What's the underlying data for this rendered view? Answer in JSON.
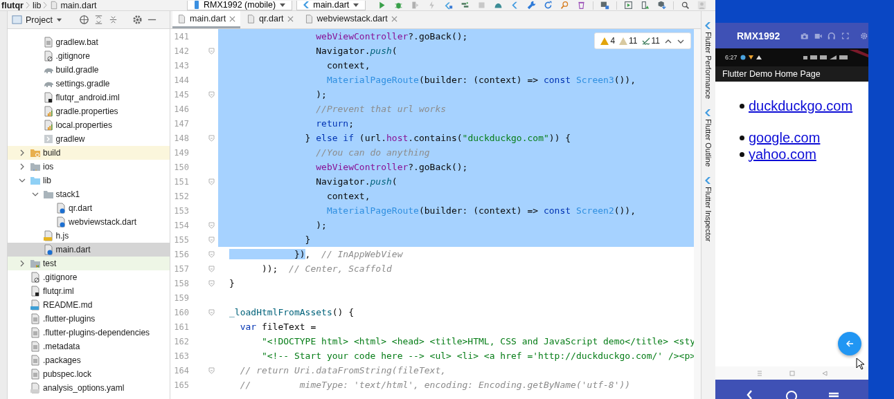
{
  "breadcrumbs": [
    "flutqr",
    "lib",
    "main.dart"
  ],
  "device_selector": {
    "label": "RMX1992 (mobile)"
  },
  "run_config": {
    "label": "main.dart"
  },
  "project_panel": {
    "title": "Project",
    "tree_continuation": [
      {
        "label": "gradlew.bat",
        "kind": "text",
        "selected": false
      },
      {
        "label": ".gitignore",
        "kind": "ignore",
        "selected": false
      },
      {
        "label": "build.gradle",
        "kind": "gradle",
        "selected": false
      },
      {
        "label": "settings.gradle",
        "kind": "gradle",
        "selected": false
      },
      {
        "label": "flutqr_android.iml",
        "kind": "iml",
        "selected": false
      },
      {
        "label": "gradle.properties",
        "kind": "properties",
        "selected": false
      },
      {
        "label": "local.properties",
        "kind": "properties",
        "selected": false
      },
      {
        "label": "gradlew",
        "kind": "script",
        "selected": false
      }
    ],
    "tree": [
      {
        "label": "build",
        "kind": "excluded-folder",
        "selected": false,
        "expanded": false
      },
      {
        "label": "ios",
        "kind": "ios-folder",
        "selected": false,
        "expanded": false
      },
      {
        "label": "lib",
        "kind": "source-folder",
        "selected": false,
        "expanded": true,
        "children": [
          {
            "label": "stack1",
            "kind": "folder",
            "selected": false,
            "expanded": true,
            "children": [
              {
                "label": "qr.dart",
                "kind": "dart",
                "selected": false
              },
              {
                "label": "webviewstack.dart",
                "kind": "dart",
                "selected": false
              }
            ]
          },
          {
            "label": "h.js",
            "kind": "js",
            "selected": false
          },
          {
            "label": "main.dart",
            "kind": "dart",
            "selected": true
          }
        ]
      },
      {
        "label": "test",
        "kind": "test-folder",
        "selected": false,
        "expanded": false
      },
      {
        "label": ".gitignore",
        "kind": "ignore",
        "selected": false
      },
      {
        "label": "flutqr.iml",
        "kind": "iml",
        "selected": false
      },
      {
        "label": "README.md",
        "kind": "markdown",
        "selected": false
      },
      {
        "label": ".flutter-plugins",
        "kind": "text",
        "selected": false
      },
      {
        "label": ".flutter-plugins-dependencies",
        "kind": "text",
        "selected": false
      },
      {
        "label": ".metadata",
        "kind": "text",
        "selected": false
      },
      {
        "label": ".packages",
        "kind": "text",
        "selected": false
      },
      {
        "label": "pubspec.lock",
        "kind": "text",
        "selected": false
      },
      {
        "label": "analysis_options.yaml",
        "kind": "yaml",
        "selected": false
      }
    ]
  },
  "editor_tabs": [
    {
      "label": "main.dart",
      "selected": true
    },
    {
      "label": "qr.dart",
      "selected": false
    },
    {
      "label": "webviewstack.dart",
      "selected": false
    }
  ],
  "inspection_widget": {
    "errors": "4",
    "warnings": "11",
    "typos": "11"
  },
  "code_lines": [
    {
      "number": "141",
      "selected": true,
      "fold": false,
      "tokens": [
        {
          "text": "                webViewController",
          "kind": "field"
        },
        {
          "text": "?.goBack();",
          "kind": "plain"
        }
      ]
    },
    {
      "number": "142",
      "selected": true,
      "fold": true,
      "tokens": [
        {
          "text": "                Navigator.",
          "kind": "plain"
        },
        {
          "text": "push",
          "kind": "method"
        },
        {
          "text": "(",
          "kind": "plain"
        }
      ]
    },
    {
      "number": "143",
      "selected": true,
      "fold": false,
      "tokens": [
        {
          "text": "                  context,",
          "kind": "plain"
        }
      ]
    },
    {
      "number": "144",
      "selected": true,
      "fold": false,
      "tokens": [
        {
          "text": "                  MaterialPageRoute",
          "kind": "class"
        },
        {
          "text": "(builder: (context) => ",
          "kind": "plain"
        },
        {
          "text": "const ",
          "kind": "keyword"
        },
        {
          "text": "Screen3",
          "kind": "class"
        },
        {
          "text": "()),",
          "kind": "plain"
        }
      ]
    },
    {
      "number": "145",
      "selected": true,
      "fold": true,
      "tokens": [
        {
          "text": "                );",
          "kind": "plain"
        }
      ]
    },
    {
      "number": "146",
      "selected": true,
      "fold": false,
      "tokens": [
        {
          "text": "                //Prevent that url works",
          "kind": "comment"
        }
      ]
    },
    {
      "number": "147",
      "selected": true,
      "fold": false,
      "tokens": [
        {
          "text": "                return",
          "kind": "keyword"
        },
        {
          "text": ";",
          "kind": "plain"
        }
      ]
    },
    {
      "number": "148",
      "selected": true,
      "fold": true,
      "tokens": [
        {
          "text": "              } ",
          "kind": "plain"
        },
        {
          "text": "else if",
          "kind": "keyword"
        },
        {
          "text": " (url.",
          "kind": "plain"
        },
        {
          "text": "host",
          "kind": "field"
        },
        {
          "text": ".contains(",
          "kind": "plain"
        },
        {
          "text": "\"duckduckgo.com\"",
          "kind": "string"
        },
        {
          "text": ")) {",
          "kind": "plain"
        }
      ]
    },
    {
      "number": "149",
      "selected": true,
      "fold": false,
      "tokens": [
        {
          "text": "                //You can do anything",
          "kind": "comment"
        }
      ]
    },
    {
      "number": "150",
      "selected": true,
      "fold": false,
      "tokens": [
        {
          "text": "                webViewController",
          "kind": "field"
        },
        {
          "text": "?.goBack();",
          "kind": "plain"
        }
      ]
    },
    {
      "number": "151",
      "selected": true,
      "fold": true,
      "tokens": [
        {
          "text": "                Navigator.",
          "kind": "plain"
        },
        {
          "text": "push",
          "kind": "method"
        },
        {
          "text": "(",
          "kind": "plain"
        }
      ]
    },
    {
      "number": "152",
      "selected": true,
      "fold": false,
      "tokens": [
        {
          "text": "                  context,",
          "kind": "plain"
        }
      ]
    },
    {
      "number": "153",
      "selected": true,
      "fold": false,
      "tokens": [
        {
          "text": "                  MaterialPageRoute",
          "kind": "class"
        },
        {
          "text": "(builder: (context) => ",
          "kind": "plain"
        },
        {
          "text": "const ",
          "kind": "keyword"
        },
        {
          "text": "Screen2",
          "kind": "class"
        },
        {
          "text": "()),",
          "kind": "plain"
        }
      ]
    },
    {
      "number": "154",
      "selected": true,
      "fold": true,
      "tokens": [
        {
          "text": "                );",
          "kind": "plain"
        }
      ]
    },
    {
      "number": "155",
      "selected": true,
      "fold": true,
      "tokens": [
        {
          "text": "              }",
          "kind": "plain"
        }
      ]
    },
    {
      "number": "156",
      "selected": false,
      "fold": true,
      "tokens": [
        {
          "text": "            })",
          "kind": "plain",
          "selected": true
        },
        {
          "text": ",  ",
          "kind": "plain",
          "selected": false
        },
        {
          "text": "// InAppWebView",
          "kind": "comment",
          "selected": false
        }
      ]
    },
    {
      "number": "157",
      "selected": false,
      "fold": true,
      "tokens": [
        {
          "text": "      ));  ",
          "kind": "plain"
        },
        {
          "text": "// Center, Scaffold",
          "kind": "comment"
        }
      ]
    },
    {
      "number": "158",
      "selected": false,
      "fold": true,
      "tokens": [
        {
          "text": "}",
          "kind": "plain"
        }
      ]
    },
    {
      "number": "159",
      "selected": false,
      "fold": false
    },
    {
      "number": "160",
      "selected": false,
      "fold": true,
      "tokens": [
        {
          "text": "_loadHtmlFromAssets",
          "kind": "function"
        },
        {
          "text": "() {",
          "kind": "plain"
        }
      ]
    },
    {
      "number": "161",
      "selected": false,
      "fold": false,
      "tokens": [
        {
          "text": "  var",
          "kind": "keyword"
        },
        {
          "text": " fileText =",
          "kind": "plain"
        }
      ]
    },
    {
      "number": "162",
      "selected": false,
      "fold": false,
      "tokens": [
        {
          "text": "      \"<!DOCTYPE html> <html> <head> <title>HTML, CSS and JavaScript demo</title> <sty",
          "kind": "string"
        }
      ]
    },
    {
      "number": "163",
      "selected": false,
      "fold": false,
      "tokens": [
        {
          "text": "      \"<!-- Start your code here --> <ul> <li> <a href ='http://duckduckgo.com/' /><p>",
          "kind": "string"
        }
      ]
    },
    {
      "number": "164",
      "selected": false,
      "fold": true,
      "tokens": [
        {
          "text": "  // return Uri.dataFromString(fileText,",
          "kind": "comment"
        }
      ]
    },
    {
      "number": "165",
      "selected": false,
      "fold": false,
      "tokens": [
        {
          "text": "  //         mimeType: 'text/html', encoding: Encoding.getByName('utf-8'))",
          "kind": "comment"
        }
      ]
    }
  ],
  "tool_window_tabs": [
    {
      "label": "Flutter Performance"
    },
    {
      "label": "Flutter Outline"
    },
    {
      "label": "Flutter Inspector"
    }
  ],
  "emulator": {
    "title": "RMX1992",
    "status_time": "6:27",
    "app_title": "Flutter Demo Home Page",
    "links": [
      {
        "text": "duckduckgo.com",
        "paragraph_after": true
      },
      {
        "text": "google.com",
        "paragraph_after": false
      },
      {
        "text": "yahoo.com",
        "paragraph_after": false
      }
    ]
  }
}
